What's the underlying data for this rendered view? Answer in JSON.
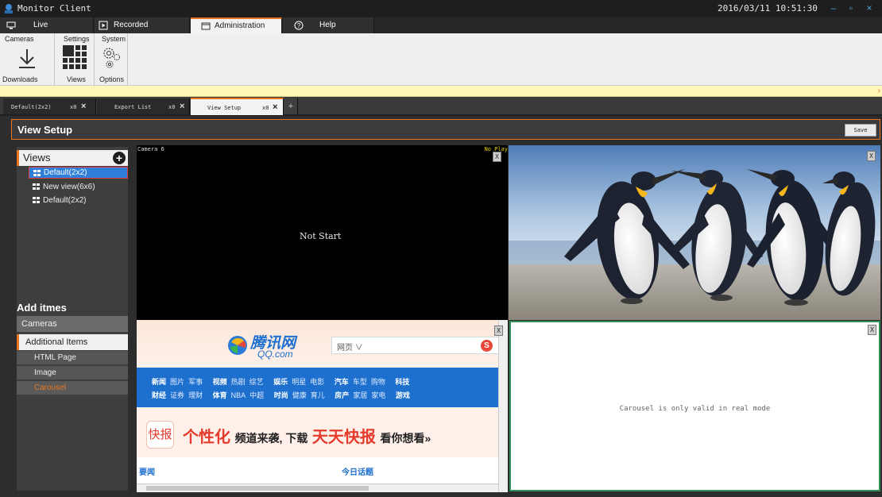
{
  "window": {
    "title": "Monitor Client",
    "clock": "2016/03/11 10:51:30"
  },
  "main_tabs": [
    {
      "label": "Live",
      "icon": "monitor-icon"
    },
    {
      "label": "Recorded",
      "icon": "play-icon"
    },
    {
      "label": "Administration",
      "icon": "window-icon"
    },
    {
      "label": "Help",
      "icon": "help-icon"
    }
  ],
  "ribbon": {
    "groups": [
      {
        "header": "Cameras",
        "footer": "Downloads",
        "icon": "download-icon"
      },
      {
        "header": "Settings",
        "footer": "Views",
        "icon": "grid-icon"
      },
      {
        "header": "System",
        "footer": "Options",
        "icon": "gear-icon"
      }
    ]
  },
  "doc_tabs": [
    {
      "label": "Default(2x2)",
      "pin": "x0"
    },
    {
      "label": "Export List",
      "pin": "x0"
    },
    {
      "label": "View Setup",
      "pin": "x0"
    }
  ],
  "view_setup": {
    "title": "View Setup",
    "save_label": "Save"
  },
  "left_panel": {
    "views_header": "Views",
    "views": [
      "Default(2x2)",
      "New view(6x6)",
      "Default(2x2)"
    ],
    "add_items_header": "Add itmes",
    "categories": [
      "Cameras",
      "Additional Items"
    ],
    "sub_items": [
      "HTML Page",
      "Image",
      "Carousel"
    ]
  },
  "cells": {
    "camera_name": "Camera 6",
    "no_play": "No Play",
    "not_start": "Not Start",
    "carousel_msg": "Carousel is only valid in real mode",
    "close_label": "X"
  },
  "web": {
    "logo": "腾讯网",
    "logo_sub": "QQ.com",
    "search_select": "网页 ∨",
    "nav_row1": [
      "新闻",
      "图片",
      "军事",
      "视频",
      "热剧",
      "综艺",
      "娱乐",
      "明星",
      "电影",
      "汽车",
      "车型",
      "购物",
      "科技"
    ],
    "nav_row2": [
      "财经",
      "证券",
      "理财",
      "体育",
      "NBA",
      "中超",
      "时尚",
      "健康",
      "育儿",
      "房产",
      "家居",
      "家电",
      "游戏"
    ],
    "banner_brand": "快报",
    "banner_big": "个性化",
    "banner_mid": "频道来袭, 下载",
    "banner_big2": "天天快报",
    "banner_end": "看你想看»",
    "news_left": "要闻",
    "news_right": "今日话题"
  },
  "colors": {
    "accent": "#e87722",
    "selection": "#2f7fd8",
    "carousel_border": "#2f8f56"
  }
}
